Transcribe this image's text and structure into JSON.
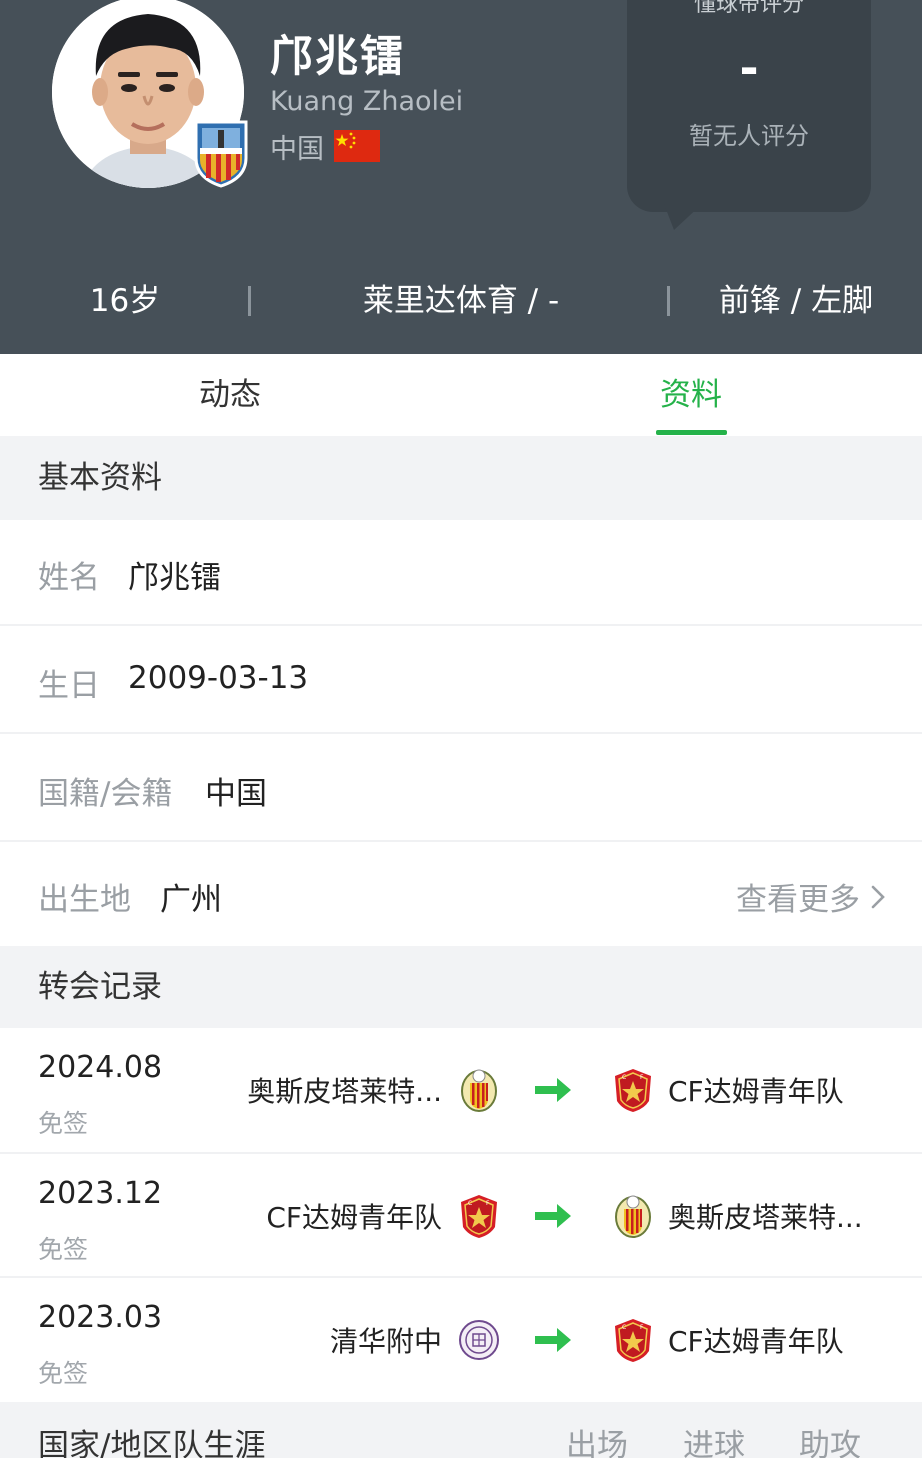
{
  "player": {
    "name_cn": "邝兆镭",
    "name_en": "Kuang Zhaolei",
    "nationality": "中国",
    "flag_icon": "china-flag-icon",
    "age": "16岁",
    "club_number": "莱里达体育 / -",
    "position_foot": "前锋 / 左脚"
  },
  "rating": {
    "title": "懂球帝评分",
    "value": "-",
    "note": "暂无人评分"
  },
  "tabs": [
    {
      "label": "动态",
      "active": false
    },
    {
      "label": "资料",
      "active": true
    }
  ],
  "colors": {
    "header_bg": "#465058",
    "accent_green": "#25b24a",
    "page_bg": "#f2f3f5"
  },
  "basic_info": {
    "title": "基本资料",
    "rows": [
      {
        "label": "姓名",
        "value": "邝兆镭"
      },
      {
        "label": "生日",
        "value": "2009-03-13"
      },
      {
        "label": "国籍/会籍",
        "value": "中国"
      },
      {
        "label": "出生地",
        "value": "广州"
      }
    ],
    "more_label": "查看更多"
  },
  "transfers": {
    "title": "转会记录",
    "items": [
      {
        "date": "2024.08",
        "type": "免签",
        "from": "奥斯皮塔莱特...",
        "from_icon": "hospitalet-badge-icon",
        "to": "CF达姆青年队",
        "to_icon": "cf-damm-badge-icon"
      },
      {
        "date": "2023.12",
        "type": "免签",
        "from": "CF达姆青年队",
        "from_icon": "cf-damm-badge-icon",
        "to": "奥斯皮塔莱特...",
        "to_icon": "hospitalet-badge-icon"
      },
      {
        "date": "2023.03",
        "type": "免签",
        "from": "清华附中",
        "from_icon": "tsinghua-school-badge-icon",
        "to": "CF达姆青年队",
        "to_icon": "cf-damm-badge-icon"
      }
    ]
  },
  "national_team": {
    "title": "国家/地区队生涯",
    "columns": [
      "出场",
      "进球",
      "助攻"
    ]
  }
}
